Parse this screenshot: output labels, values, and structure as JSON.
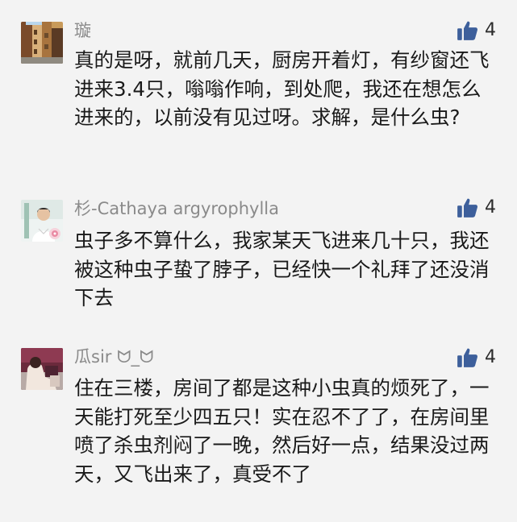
{
  "comments": [
    {
      "username": "璇",
      "likes": "4",
      "text": "真的是呀，就前几天，厨房开着灯，有纱窗还飞进来3.4只，嗡嗡作响，到处爬，我还在想怎么进来的，以前没有见过呀。求解，是什么虫?"
    },
    {
      "username": "杉-Cathaya argyrophylla",
      "likes": "4",
      "text": "虫子多不算什么，我家某天飞进来几十只，我还被这种虫子蛰了脖子，已经快一个礼拜了还没消下去"
    },
    {
      "username": "瓜sir ᗢ_ᗢ",
      "likes": "4",
      "text": "住在三楼，房间了都是这种小虫真的烦死了，一天能打死至少四五只！实在忍不了了，在房间里喷了杀虫剂闷了一晚，然后好一点，结果没过两天，又飞出来了，真受不了"
    }
  ],
  "colors": {
    "background": "#f3f3f3",
    "username": "#8a8a8a",
    "like_icon": "#3d5f9b",
    "text": "#1a1a1a"
  },
  "icons": {
    "like": "thumbs-up-icon"
  }
}
